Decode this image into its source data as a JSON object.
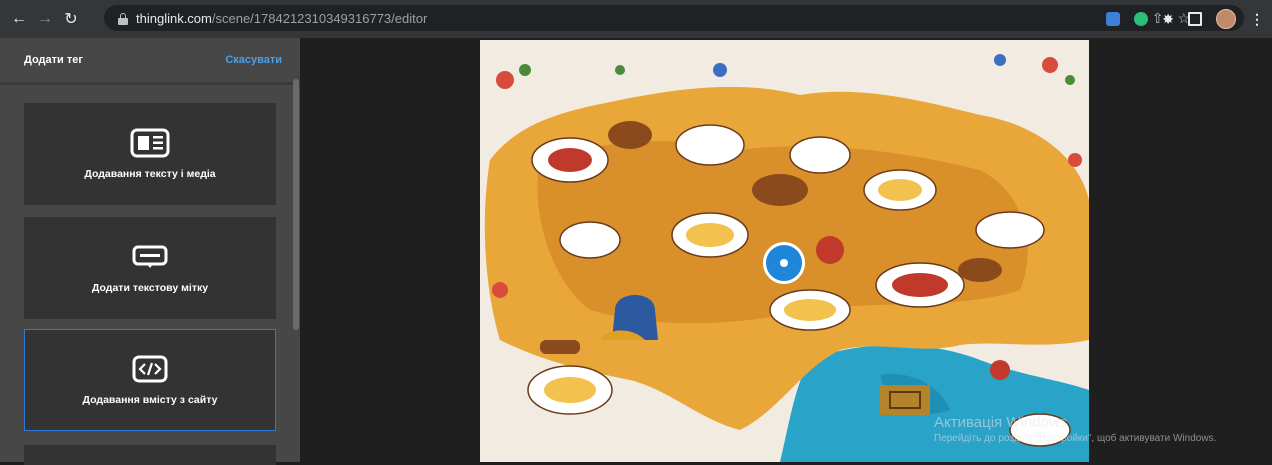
{
  "browser": {
    "url_host": "thinglink.com",
    "url_path": "/scene/1784212310349316773/editor"
  },
  "panel": {
    "title": "Додати тег",
    "cancel_label": "Скасувати",
    "cards": [
      {
        "label": "Додавання тексту і медіа",
        "icon": "text-media-icon"
      },
      {
        "label": "Додати текстову мітку",
        "icon": "text-label-icon"
      },
      {
        "label": "Додавання вмісту з сайту",
        "icon": "embed-code-icon"
      }
    ]
  },
  "scene": {
    "image": "illustrated-food-map-of-ukraine",
    "tag": "tag-hotspot"
  },
  "watermark": {
    "title": "Активація Windows",
    "subtitle": "Перейдіть до розділу \"Настройки\", щоб активувати Windows."
  },
  "colors": {
    "accent": "#2f79d6",
    "link": "#4a9fe8",
    "hotspot": "#1f86d9"
  }
}
